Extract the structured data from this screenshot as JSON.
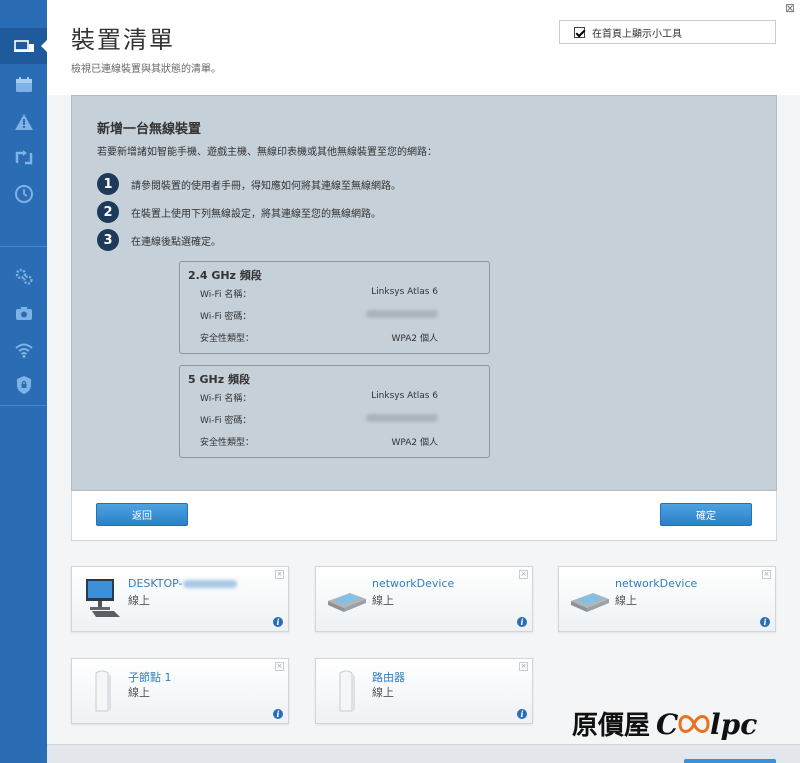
{
  "page": {
    "title": "裝置清單",
    "subtitle": "檢視已連線裝置與其狀態的清單。",
    "widget_label": "在首頁上顯示小工具",
    "close_glyph": "⊠"
  },
  "sidebar": {
    "items": [
      {
        "icon": "device-list-icon",
        "active": true
      },
      {
        "icon": "calendar-icon",
        "active": false
      },
      {
        "icon": "warning-icon",
        "active": false
      },
      {
        "icon": "updates-icon",
        "active": false
      },
      {
        "icon": "clock-icon",
        "active": false
      },
      {
        "icon": "gear-icon",
        "active": false
      },
      {
        "icon": "camera-icon",
        "active": false
      },
      {
        "icon": "wifi-icon",
        "active": false
      },
      {
        "icon": "shield-icon",
        "active": false
      }
    ]
  },
  "dialog": {
    "title": "新增一台無線裝置",
    "description": "若要新增諸如智能手機、遊戲主機、無線印表機或其他無線裝置至您的網路：",
    "steps": [
      {
        "num": "1",
        "text": "請參閱裝置的使用者手冊，得知應如何將其連線至無線網路。"
      },
      {
        "num": "2",
        "text": "在裝置上使用下列無線設定，將其連線至您的無線網路。"
      },
      {
        "num": "3",
        "text": "在連線後點選確定。"
      }
    ],
    "bands": [
      {
        "title": "2.4 GHz 頻段",
        "rows": [
          {
            "label": "Wi-Fi 名稱：",
            "value": "Linksys Atlas 6"
          },
          {
            "label": "Wi-Fi 密碼：",
            "value": ""
          },
          {
            "label": "安全性類型：",
            "value": "WPA2 個人"
          }
        ]
      },
      {
        "title": "5 GHz 頻段",
        "rows": [
          {
            "label": "Wi-Fi 名稱：",
            "value": "Linksys Atlas 6"
          },
          {
            "label": "Wi-Fi 密碼：",
            "value": ""
          },
          {
            "label": "安全性類型：",
            "value": "WPA2 個人"
          }
        ]
      }
    ],
    "back_label": "返回",
    "ok_label": "確定"
  },
  "devices": [
    {
      "name": "DESKTOP-",
      "status": "線上",
      "icon": "desktop-icon"
    },
    {
      "name": "networkDevice",
      "status": "線上",
      "icon": "network-device-icon"
    },
    {
      "name": "networkDevice",
      "status": "線上",
      "icon": "network-device-icon"
    },
    {
      "name": "子節點 1",
      "status": "線上",
      "icon": "node-icon"
    },
    {
      "name": "路由器",
      "status": "線上",
      "icon": "router-icon"
    }
  ],
  "watermark": {
    "text": "原價屋",
    "brand": "Coolpc"
  },
  "colors": {
    "accent": "#2b6db5",
    "panel": "#c6d0d8",
    "button": "#2b80c7",
    "link": "#2d7fc4"
  }
}
